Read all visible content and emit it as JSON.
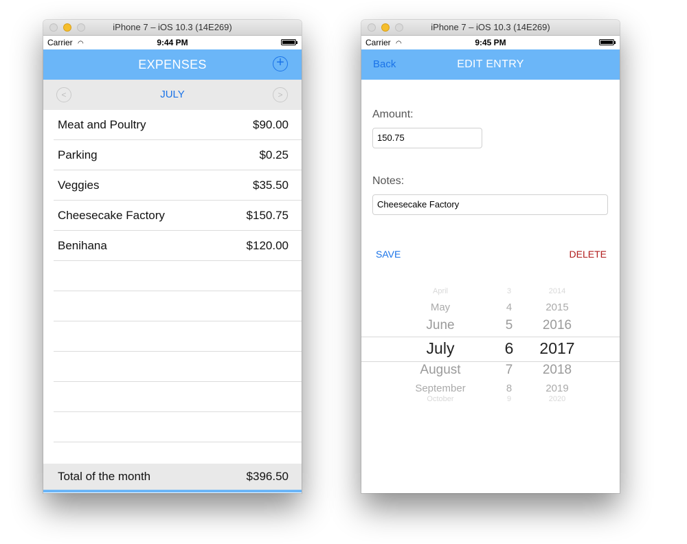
{
  "left_window": {
    "title": "iPhone 7 – iOS 10.3 (14E269)",
    "status": {
      "carrier": "Carrier",
      "time": "9:44 PM"
    },
    "nav": {
      "title": "EXPENSES",
      "add_symbol": "+"
    },
    "month": {
      "label": "JULY",
      "prev_symbol": "<",
      "next_symbol": ">"
    },
    "expenses": [
      {
        "name": "Meat and Poultry",
        "amount": "$90.00"
      },
      {
        "name": "Parking",
        "amount": "$0.25"
      },
      {
        "name": "Veggies",
        "amount": "$35.50"
      },
      {
        "name": "Cheesecake Factory",
        "amount": "$150.75"
      },
      {
        "name": "Benihana",
        "amount": "$120.00"
      }
    ],
    "total": {
      "label": "Total of the month",
      "value": "$396.50"
    }
  },
  "right_window": {
    "title": "iPhone 7 – iOS 10.3 (14E269)",
    "status": {
      "carrier": "Carrier",
      "time": "9:45 PM"
    },
    "nav": {
      "back": "Back",
      "title": "EDIT ENTRY"
    },
    "form": {
      "amount_label": "Amount:",
      "amount_value": "150.75",
      "notes_label": "Notes:",
      "notes_value": "Cheesecake Factory",
      "save_label": "SAVE",
      "delete_label": "DELETE"
    },
    "date_picker": {
      "months": [
        "April",
        "May",
        "June",
        "July",
        "August",
        "September",
        "October"
      ],
      "days": [
        "3",
        "4",
        "5",
        "6",
        "7",
        "8",
        "9"
      ],
      "years": [
        "2014",
        "2015",
        "2016",
        "2017",
        "2018",
        "2019",
        "2020"
      ],
      "selected": {
        "month": "July",
        "day": "6",
        "year": "2017"
      }
    }
  },
  "colors": {
    "nav_bar": "#6bb6f8",
    "accent_blue": "#1a73e8",
    "delete_red": "#b01a1a",
    "section_bg": "#e9e9e9"
  },
  "icons": [
    "close-icon",
    "minimize-icon",
    "zoom-icon",
    "wifi-icon",
    "battery-icon",
    "add-circle-icon",
    "chevron-left-icon",
    "chevron-right-icon"
  ]
}
